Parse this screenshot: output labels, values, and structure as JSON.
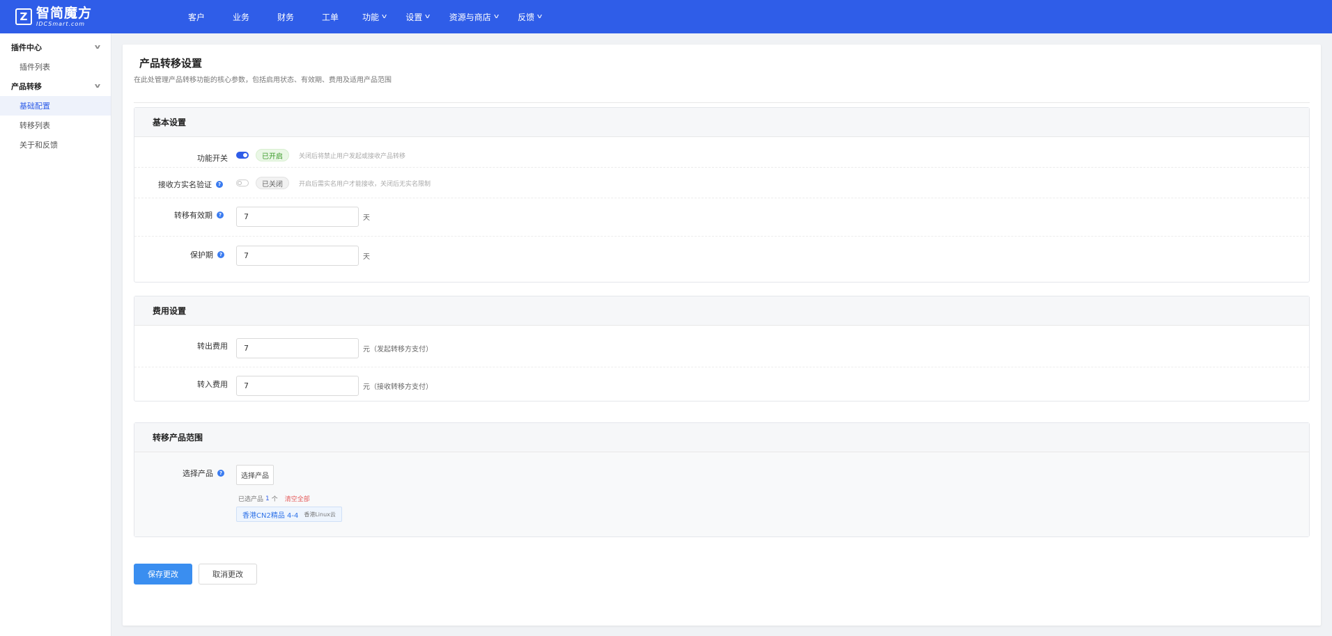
{
  "logo": {
    "mark": "Z",
    "cn": "智简魔方",
    "en": "IDCSmart.com"
  },
  "nav": [
    {
      "label": "客户",
      "has_menu": false
    },
    {
      "label": "业务",
      "has_menu": false
    },
    {
      "label": "财务",
      "has_menu": false
    },
    {
      "label": "工单",
      "has_menu": false
    },
    {
      "label": "功能",
      "has_menu": true
    },
    {
      "label": "设置",
      "has_menu": true
    },
    {
      "label": "资源与商店",
      "has_menu": true
    },
    {
      "label": "反馈",
      "has_menu": true
    }
  ],
  "sidebar": {
    "groups": [
      {
        "label": "插件中心",
        "items": [
          "插件列表"
        ]
      },
      {
        "label": "产品转移",
        "items": [
          "基础配置",
          "转移列表",
          "关于和反馈"
        ]
      }
    ],
    "active": "基础配置"
  },
  "page": {
    "title": "产品转移设置",
    "desc": "在此处管理产品转移功能的核心参数，包括启用状态、有效期、费用及适用产品范围"
  },
  "basic": {
    "title": "基本设置",
    "switch": {
      "label": "功能开关",
      "state": "已开启",
      "hint": "关闭后将禁止用户发起或接收产品转移"
    },
    "realname": {
      "label": "接收方实名验证",
      "state": "已关闭",
      "hint": "开启后需实名用户才能接收，关闭后无实名限制"
    },
    "validity": {
      "label": "转移有效期",
      "value": "7",
      "unit": "天"
    },
    "protect": {
      "label": "保护期",
      "value": "7",
      "unit": "天"
    }
  },
  "fee": {
    "title": "费用设置",
    "out": {
      "label": "转出费用",
      "value": "7",
      "unit": "元（发起转移方支付）"
    },
    "in": {
      "label": "转入费用",
      "value": "7",
      "unit": "元（接收转移方支付）"
    }
  },
  "scope": {
    "title": "转移产品范围",
    "label": "选择产品",
    "button": "选择产品",
    "selected_prefix": "已选产品",
    "selected_count": "1",
    "selected_suffix": "个",
    "clear": "清空全部",
    "tag": {
      "name": "香港CN2精品 4-4",
      "sub": "香港Linux云"
    }
  },
  "actions": {
    "save": "保存更改",
    "cancel": "取消更改"
  },
  "colors": {
    "primary": "#2f5de8",
    "button": "#3a8ef0",
    "on": "#3a9a2a",
    "danger": "#e45a5a"
  }
}
